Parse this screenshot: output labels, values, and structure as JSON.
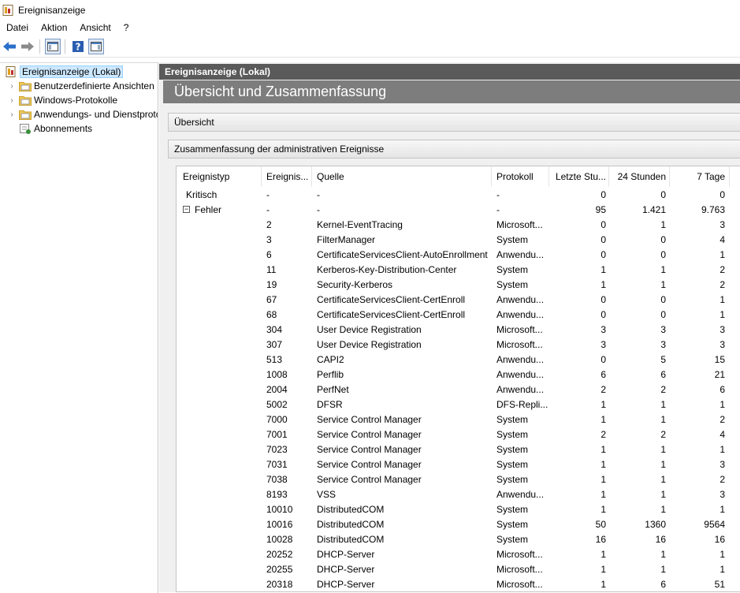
{
  "window": {
    "title": "Ereignisanzeige"
  },
  "menu": {
    "items": [
      "Datei",
      "Aktion",
      "Ansicht",
      "?"
    ]
  },
  "tree": {
    "items": [
      {
        "label": "Ereignisanzeige (Lokal)",
        "selected": true,
        "arrow": ""
      },
      {
        "label": "Benutzerdefinierte Ansichten",
        "arrow": "›"
      },
      {
        "label": "Windows-Protokolle",
        "arrow": "›"
      },
      {
        "label": "Anwendungs- und Dienstprotokolle",
        "arrow": "›"
      },
      {
        "label": "Abonnements",
        "arrow": ""
      }
    ]
  },
  "right": {
    "header": "Ereignisanzeige (Lokal)",
    "banner": "Übersicht und Zusammenfassung",
    "sections": {
      "overview": "Übersicht",
      "summary": "Zusammenfassung der administrativen Ereignisse"
    }
  },
  "table": {
    "columns": [
      "Ereignistyp",
      "Ereignis...",
      "Quelle",
      "Protokoll",
      "Letzte Stu...",
      "24 Stunden",
      "7 Tage"
    ],
    "groups": [
      {
        "type": "Kritisch",
        "id": "-",
        "source": "-",
        "log": "-",
        "h": "0",
        "d": "0",
        "w": "0",
        "expandable": false
      },
      {
        "type": "Fehler",
        "id": "-",
        "source": "-",
        "log": "-",
        "h": "95",
        "d": "1.421",
        "w": "9.763",
        "expandable": true,
        "expanded_glyph": "−"
      }
    ],
    "rows": [
      {
        "id": "2",
        "source": "Kernel-EventTracing",
        "log": "Microsoft...",
        "h": "0",
        "d": "1",
        "w": "3"
      },
      {
        "id": "3",
        "source": "FilterManager",
        "log": "System",
        "h": "0",
        "d": "0",
        "w": "4"
      },
      {
        "id": "6",
        "source": "CertificateServicesClient-AutoEnrollment",
        "log": "Anwendu...",
        "h": "0",
        "d": "0",
        "w": "1"
      },
      {
        "id": "11",
        "source": "Kerberos-Key-Distribution-Center",
        "log": "System",
        "h": "1",
        "d": "1",
        "w": "2"
      },
      {
        "id": "19",
        "source": "Security-Kerberos",
        "log": "System",
        "h": "1",
        "d": "1",
        "w": "2"
      },
      {
        "id": "67",
        "source": "CertificateServicesClient-CertEnroll",
        "log": "Anwendu...",
        "h": "0",
        "d": "0",
        "w": "1"
      },
      {
        "id": "68",
        "source": "CertificateServicesClient-CertEnroll",
        "log": "Anwendu...",
        "h": "0",
        "d": "0",
        "w": "1"
      },
      {
        "id": "304",
        "source": "User Device Registration",
        "log": "Microsoft...",
        "h": "3",
        "d": "3",
        "w": "3"
      },
      {
        "id": "307",
        "source": "User Device Registration",
        "log": "Microsoft...",
        "h": "3",
        "d": "3",
        "w": "3"
      },
      {
        "id": "513",
        "source": "CAPI2",
        "log": "Anwendu...",
        "h": "0",
        "d": "5",
        "w": "15"
      },
      {
        "id": "1008",
        "source": "Perflib",
        "log": "Anwendu...",
        "h": "6",
        "d": "6",
        "w": "21"
      },
      {
        "id": "2004",
        "source": "PerfNet",
        "log": "Anwendu...",
        "h": "2",
        "d": "2",
        "w": "6"
      },
      {
        "id": "5002",
        "source": "DFSR",
        "log": "DFS-Repli...",
        "h": "1",
        "d": "1",
        "w": "1"
      },
      {
        "id": "7000",
        "source": "Service Control Manager",
        "log": "System",
        "h": "1",
        "d": "1",
        "w": "2"
      },
      {
        "id": "7001",
        "source": "Service Control Manager",
        "log": "System",
        "h": "2",
        "d": "2",
        "w": "4"
      },
      {
        "id": "7023",
        "source": "Service Control Manager",
        "log": "System",
        "h": "1",
        "d": "1",
        "w": "1"
      },
      {
        "id": "7031",
        "source": "Service Control Manager",
        "log": "System",
        "h": "1",
        "d": "1",
        "w": "3"
      },
      {
        "id": "7038",
        "source": "Service Control Manager",
        "log": "System",
        "h": "1",
        "d": "1",
        "w": "2"
      },
      {
        "id": "8193",
        "source": "VSS",
        "log": "Anwendu...",
        "h": "1",
        "d": "1",
        "w": "3"
      },
      {
        "id": "10010",
        "source": "DistributedCOM",
        "log": "System",
        "h": "1",
        "d": "1",
        "w": "1"
      },
      {
        "id": "10016",
        "source": "DistributedCOM",
        "log": "System",
        "h": "50",
        "d": "1360",
        "w": "9564"
      },
      {
        "id": "10028",
        "source": "DistributedCOM",
        "log": "System",
        "h": "16",
        "d": "16",
        "w": "16"
      },
      {
        "id": "20252",
        "source": "DHCP-Server",
        "log": "Microsoft...",
        "h": "1",
        "d": "1",
        "w": "1"
      },
      {
        "id": "20255",
        "source": "DHCP-Server",
        "log": "Microsoft...",
        "h": "1",
        "d": "1",
        "w": "1"
      },
      {
        "id": "20318",
        "source": "DHCP-Server",
        "log": "Microsoft...",
        "h": "1",
        "d": "6",
        "w": "51"
      }
    ]
  }
}
